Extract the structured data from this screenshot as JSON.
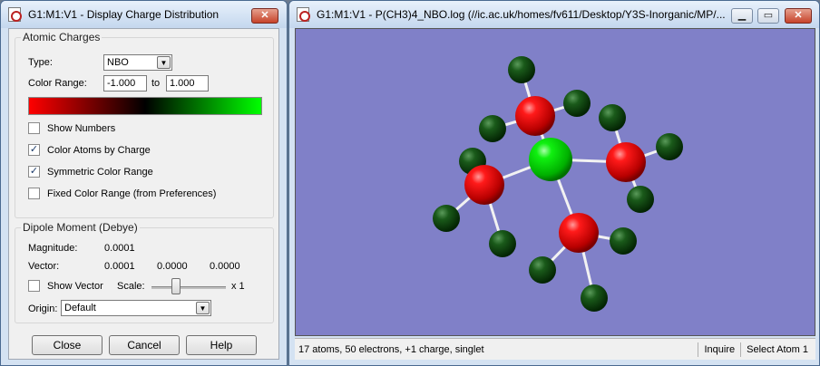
{
  "dialog": {
    "title": "G1:M1:V1 - Display Charge Distribution",
    "atomic_charges": {
      "group_title": "Atomic Charges",
      "type_label": "Type:",
      "type_value": "NBO",
      "color_range_label": "Color Range:",
      "range_min": "-1.000",
      "to_label": "to",
      "range_max": "1.000",
      "gradient_colors": [
        "#ff0000",
        "#000000",
        "#00ff00"
      ],
      "options": [
        {
          "label": "Show Numbers",
          "checked": false
        },
        {
          "label": "Color Atoms by Charge",
          "checked": true
        },
        {
          "label": "Symmetric Color Range",
          "checked": true
        },
        {
          "label": "Fixed Color Range (from Preferences)",
          "checked": false
        }
      ]
    },
    "dipole": {
      "group_title": "Dipole Moment (Debye)",
      "magnitude_label": "Magnitude:",
      "magnitude": "0.0001",
      "vector_label": "Vector:",
      "vector": [
        "0.0001",
        "0.0000",
        "0.0000"
      ],
      "show_vector_label": "Show Vector",
      "show_vector_checked": false,
      "scale_label": "Scale:",
      "scale_value": "x 1",
      "origin_label": "Origin:",
      "origin_value": "Default"
    },
    "buttons": {
      "close": "Close",
      "cancel": "Cancel",
      "help": "Help"
    }
  },
  "viewer": {
    "title": "G1:M1:V1 - P(CH3)4_NBO.log (//ic.ac.uk/homes/fv611/Desktop/Y3S-Inorganic/MP/...",
    "background_color": "#8080c8",
    "status": {
      "summary": "17 atoms, 50 electrons, +1 charge, singlet",
      "mode": "Inquire",
      "action": "Select Atom 1"
    }
  }
}
